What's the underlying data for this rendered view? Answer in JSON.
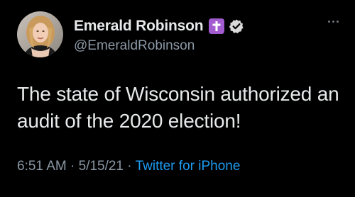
{
  "author": {
    "display_name": "Emerald Robinson",
    "handle": "@EmeraldRobinson",
    "badge_icon": "cross-icon",
    "verified_icon": "verified-check-icon",
    "badge_color": "#a35bd0"
  },
  "tweet": {
    "text": "The state of Wisconsin authorized an audit of the 2020 election!",
    "time": "6:51 AM",
    "separator_1": " · ",
    "date": "5/15/21",
    "separator_2": " · ",
    "source": "Twitter for iPhone"
  },
  "more_icon": "more-horizontal-icon",
  "colors": {
    "background": "#000000",
    "primary_text": "#e7e9ea",
    "secondary_text": "#8b98a5",
    "link": "#1d9bf0"
  }
}
